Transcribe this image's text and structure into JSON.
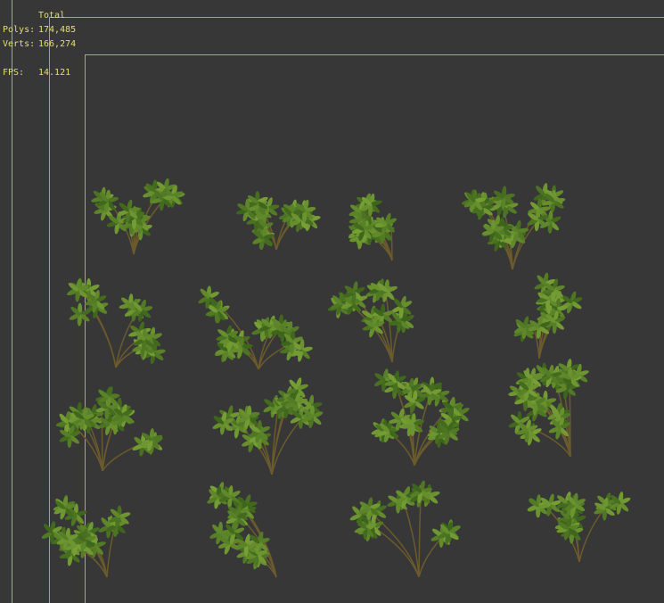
{
  "stats": {
    "header": "Total",
    "polys_label": "Polys:",
    "polys_value": "174,485",
    "verts_label": "Verts:",
    "verts_value": "166,274",
    "fps_label": "FPS:",
    "fps_value": "14.121"
  },
  "colors": {
    "background": "#373737",
    "safe_frame": "#c8a82a",
    "grid_axis": "#3fc6c6",
    "stats_text": "#e6df6e",
    "leaf": "#4f6e2c"
  },
  "scene": {
    "object": "plant-models",
    "count": 16
  }
}
